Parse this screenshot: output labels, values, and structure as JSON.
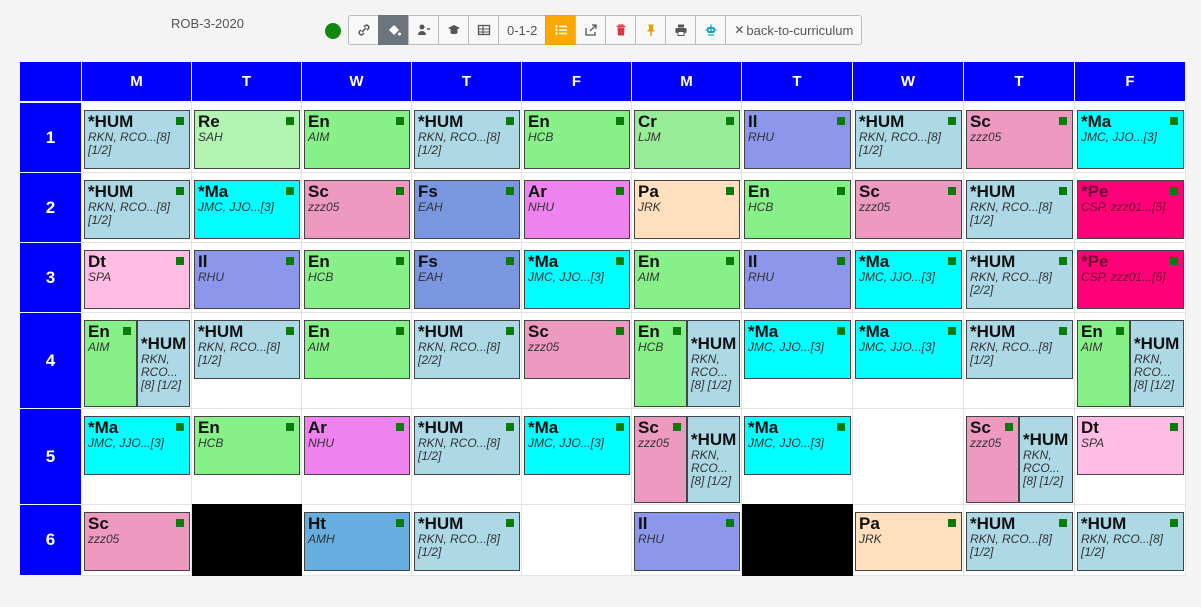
{
  "title": "ROB-3-2020",
  "toolbar": {
    "buttons": [
      {
        "icon": "link-icon",
        "label": ""
      },
      {
        "icon": "paint-bucket-icon",
        "label": "",
        "active": true
      },
      {
        "icon": "teacher-icon",
        "label": ""
      },
      {
        "icon": "graduation-cap-icon",
        "label": ""
      },
      {
        "icon": "table-icon",
        "label": ""
      },
      {
        "icon": "",
        "label": "0-1-2"
      },
      {
        "icon": "list-icon",
        "label": "",
        "active": true
      },
      {
        "icon": "export-icon",
        "label": ""
      },
      {
        "icon": "trash-icon",
        "label": ""
      },
      {
        "icon": "pin-icon",
        "label": ""
      },
      {
        "icon": "print-icon",
        "label": ""
      },
      {
        "icon": "robot-icon",
        "label": ""
      }
    ],
    "back_label": "back-to-curriculum",
    "back_icon": "close-icon"
  },
  "days": [
    "M",
    "T",
    "W",
    "T",
    "F",
    "M",
    "T",
    "W",
    "T",
    "F"
  ],
  "periods": [
    "1",
    "2",
    "3",
    "4",
    "5",
    "6"
  ],
  "black_slots": [
    [
      5,
      1
    ],
    [
      5,
      6
    ]
  ],
  "lessons": [
    {
      "p": 0,
      "d": 0,
      "subj": "*HUM",
      "tch": "RKN, RCO...[8]",
      "extra": "[1/2]",
      "color": "HUM"
    },
    {
      "p": 0,
      "d": 1,
      "subj": "Re",
      "tch": "SAH",
      "color": "Re"
    },
    {
      "p": 0,
      "d": 2,
      "subj": "En",
      "tch": "AIM",
      "color": "En"
    },
    {
      "p": 0,
      "d": 3,
      "subj": "*HUM",
      "tch": "RKN, RCO...[8]",
      "extra": "[1/2]",
      "color": "HUM"
    },
    {
      "p": 0,
      "d": 4,
      "subj": "En",
      "tch": "HCB",
      "color": "En"
    },
    {
      "p": 0,
      "d": 5,
      "subj": "Cr",
      "tch": "LJM",
      "color": "Cr"
    },
    {
      "p": 0,
      "d": 6,
      "subj": "Il",
      "tch": "RHU",
      "color": "Il"
    },
    {
      "p": 0,
      "d": 7,
      "subj": "*HUM",
      "tch": "RKN, RCO...[8]",
      "extra": "[1/2]",
      "color": "HUM"
    },
    {
      "p": 0,
      "d": 8,
      "subj": "Sc",
      "tch": "zzz05",
      "color": "Sc"
    },
    {
      "p": 0,
      "d": 9,
      "subj": "*Ma",
      "tch": "JMC, JJO...[3]",
      "color": "Ma"
    },
    {
      "p": 1,
      "d": 0,
      "subj": "*HUM",
      "tch": "RKN, RCO...[8]",
      "extra": "[1/2]",
      "color": "HUM"
    },
    {
      "p": 1,
      "d": 1,
      "subj": "*Ma",
      "tch": "JMC, JJO...[3]",
      "color": "Ma"
    },
    {
      "p": 1,
      "d": 2,
      "subj": "Sc",
      "tch": "zzz05",
      "color": "Sc"
    },
    {
      "p": 1,
      "d": 3,
      "subj": "Fs",
      "tch": "EAH",
      "color": "Fs"
    },
    {
      "p": 1,
      "d": 4,
      "subj": "Ar",
      "tch": "NHU",
      "color": "Ar"
    },
    {
      "p": 1,
      "d": 5,
      "subj": "Pa",
      "tch": "JRK",
      "color": "Pa"
    },
    {
      "p": 1,
      "d": 6,
      "subj": "En",
      "tch": "HCB",
      "color": "En"
    },
    {
      "p": 1,
      "d": 7,
      "subj": "Sc",
      "tch": "zzz05",
      "color": "Sc"
    },
    {
      "p": 1,
      "d": 8,
      "subj": "*HUM",
      "tch": "RKN, RCO...[8]",
      "extra": "[1/2]",
      "color": "HUM"
    },
    {
      "p": 1,
      "d": 9,
      "subj": "*Pe",
      "tch": "CSP, zzz01...[5]",
      "color": "Pe"
    },
    {
      "p": 2,
      "d": 0,
      "subj": "Dt",
      "tch": "SPA",
      "color": "Dt"
    },
    {
      "p": 2,
      "d": 1,
      "subj": "Il",
      "tch": "RHU",
      "color": "Il"
    },
    {
      "p": 2,
      "d": 2,
      "subj": "En",
      "tch": "HCB",
      "color": "En"
    },
    {
      "p": 2,
      "d": 3,
      "subj": "Fs",
      "tch": "EAH",
      "color": "Fs"
    },
    {
      "p": 2,
      "d": 4,
      "subj": "*Ma",
      "tch": "JMC, JJO...[3]",
      "color": "Ma"
    },
    {
      "p": 2,
      "d": 5,
      "subj": "En",
      "tch": "AIM",
      "color": "En"
    },
    {
      "p": 2,
      "d": 6,
      "subj": "Il",
      "tch": "RHU",
      "color": "Il"
    },
    {
      "p": 2,
      "d": 7,
      "subj": "*Ma",
      "tch": "JMC, JJO...[3]",
      "color": "Ma"
    },
    {
      "p": 2,
      "d": 8,
      "subj": "*HUM",
      "tch": "RKN, RCO...[8]",
      "extra": "[2/2]",
      "color": "HUM"
    },
    {
      "p": 2,
      "d": 9,
      "subj": "*Pe",
      "tch": "CSP, zzz01...[5]",
      "color": "Pe"
    },
    {
      "p": 3,
      "d": 0,
      "subj": "En",
      "tch": "AIM",
      "color": "En",
      "split": "left"
    },
    {
      "p": 3,
      "d": 0,
      "subj": "*HUM",
      "tch": "RKN, RCO... [8] [1/2]",
      "color": "HUM",
      "split": "right"
    },
    {
      "p": 3,
      "d": 1,
      "subj": "*HUM",
      "tch": "RKN, RCO...[8]",
      "extra": "[1/2]",
      "color": "HUM"
    },
    {
      "p": 3,
      "d": 2,
      "subj": "En",
      "tch": "AIM",
      "color": "En"
    },
    {
      "p": 3,
      "d": 3,
      "subj": "*HUM",
      "tch": "RKN, RCO...[8]",
      "extra": "[2/2]",
      "color": "HUM"
    },
    {
      "p": 3,
      "d": 4,
      "subj": "Sc",
      "tch": "zzz05",
      "color": "Sc"
    },
    {
      "p": 3,
      "d": 5,
      "subj": "En",
      "tch": "HCB",
      "color": "En",
      "split": "left"
    },
    {
      "p": 3,
      "d": 5,
      "subj": "*HUM",
      "tch": "RKN, RCO... [8] [1/2]",
      "color": "HUM",
      "split": "right"
    },
    {
      "p": 3,
      "d": 6,
      "subj": "*Ma",
      "tch": "JMC, JJO...[3]",
      "color": "Ma"
    },
    {
      "p": 3,
      "d": 7,
      "subj": "*Ma",
      "tch": "JMC, JJO...[3]",
      "color": "Ma"
    },
    {
      "p": 3,
      "d": 8,
      "subj": "*HUM",
      "tch": "RKN, RCO...[8]",
      "extra": "[1/2]",
      "color": "HUM"
    },
    {
      "p": 3,
      "d": 9,
      "subj": "En",
      "tch": "AIM",
      "color": "En",
      "split": "left"
    },
    {
      "p": 3,
      "d": 9,
      "subj": "*HUM",
      "tch": "RKN, RCO... [8] [1/2]",
      "color": "HUM",
      "split": "right"
    },
    {
      "p": 4,
      "d": 0,
      "subj": "*Ma",
      "tch": "JMC, JJO...[3]",
      "color": "Ma"
    },
    {
      "p": 4,
      "d": 1,
      "subj": "En",
      "tch": "HCB",
      "color": "En"
    },
    {
      "p": 4,
      "d": 2,
      "subj": "Ar",
      "tch": "NHU",
      "color": "Ar"
    },
    {
      "p": 4,
      "d": 3,
      "subj": "*HUM",
      "tch": "RKN, RCO...[8]",
      "extra": "[1/2]",
      "color": "HUM"
    },
    {
      "p": 4,
      "d": 4,
      "subj": "*Ma",
      "tch": "JMC, JJO...[3]",
      "color": "Ma"
    },
    {
      "p": 4,
      "d": 5,
      "subj": "Sc",
      "tch": "zzz05",
      "color": "Sc",
      "split": "left"
    },
    {
      "p": 4,
      "d": 5,
      "subj": "*HUM",
      "tch": "RKN, RCO... [8] [1/2]",
      "color": "HUM",
      "split": "right"
    },
    {
      "p": 4,
      "d": 6,
      "subj": "*Ma",
      "tch": "JMC, JJO...[3]",
      "color": "Ma"
    },
    {
      "p": 4,
      "d": 8,
      "subj": "Sc",
      "tch": "zzz05",
      "color": "Sc",
      "split": "left"
    },
    {
      "p": 4,
      "d": 8,
      "subj": "*HUM",
      "tch": "RKN, RCO... [8] [1/2]",
      "color": "HUM",
      "split": "right"
    },
    {
      "p": 4,
      "d": 9,
      "subj": "Dt",
      "tch": "SPA",
      "color": "Dt"
    },
    {
      "p": 5,
      "d": 0,
      "subj": "Sc",
      "tch": "zzz05",
      "color": "Sc"
    },
    {
      "p": 5,
      "d": 2,
      "subj": "Ht",
      "tch": "AMH",
      "color": "Ht"
    },
    {
      "p": 5,
      "d": 3,
      "subj": "*HUM",
      "tch": "RKN, RCO...[8]",
      "extra": "[1/2]",
      "color": "HUM"
    },
    {
      "p": 5,
      "d": 5,
      "subj": "Il",
      "tch": "RHU",
      "color": "Il"
    },
    {
      "p": 5,
      "d": 7,
      "subj": "Pa",
      "tch": "JRK",
      "color": "Pa"
    },
    {
      "p": 5,
      "d": 8,
      "subj": "*HUM",
      "tch": "RKN, RCO...[8]",
      "extra": "[1/2]",
      "color": "HUM"
    },
    {
      "p": 5,
      "d": 9,
      "subj": "*HUM",
      "tch": "RKN, RCO...[8]",
      "extra": "[1/2]",
      "color": "HUM"
    }
  ]
}
